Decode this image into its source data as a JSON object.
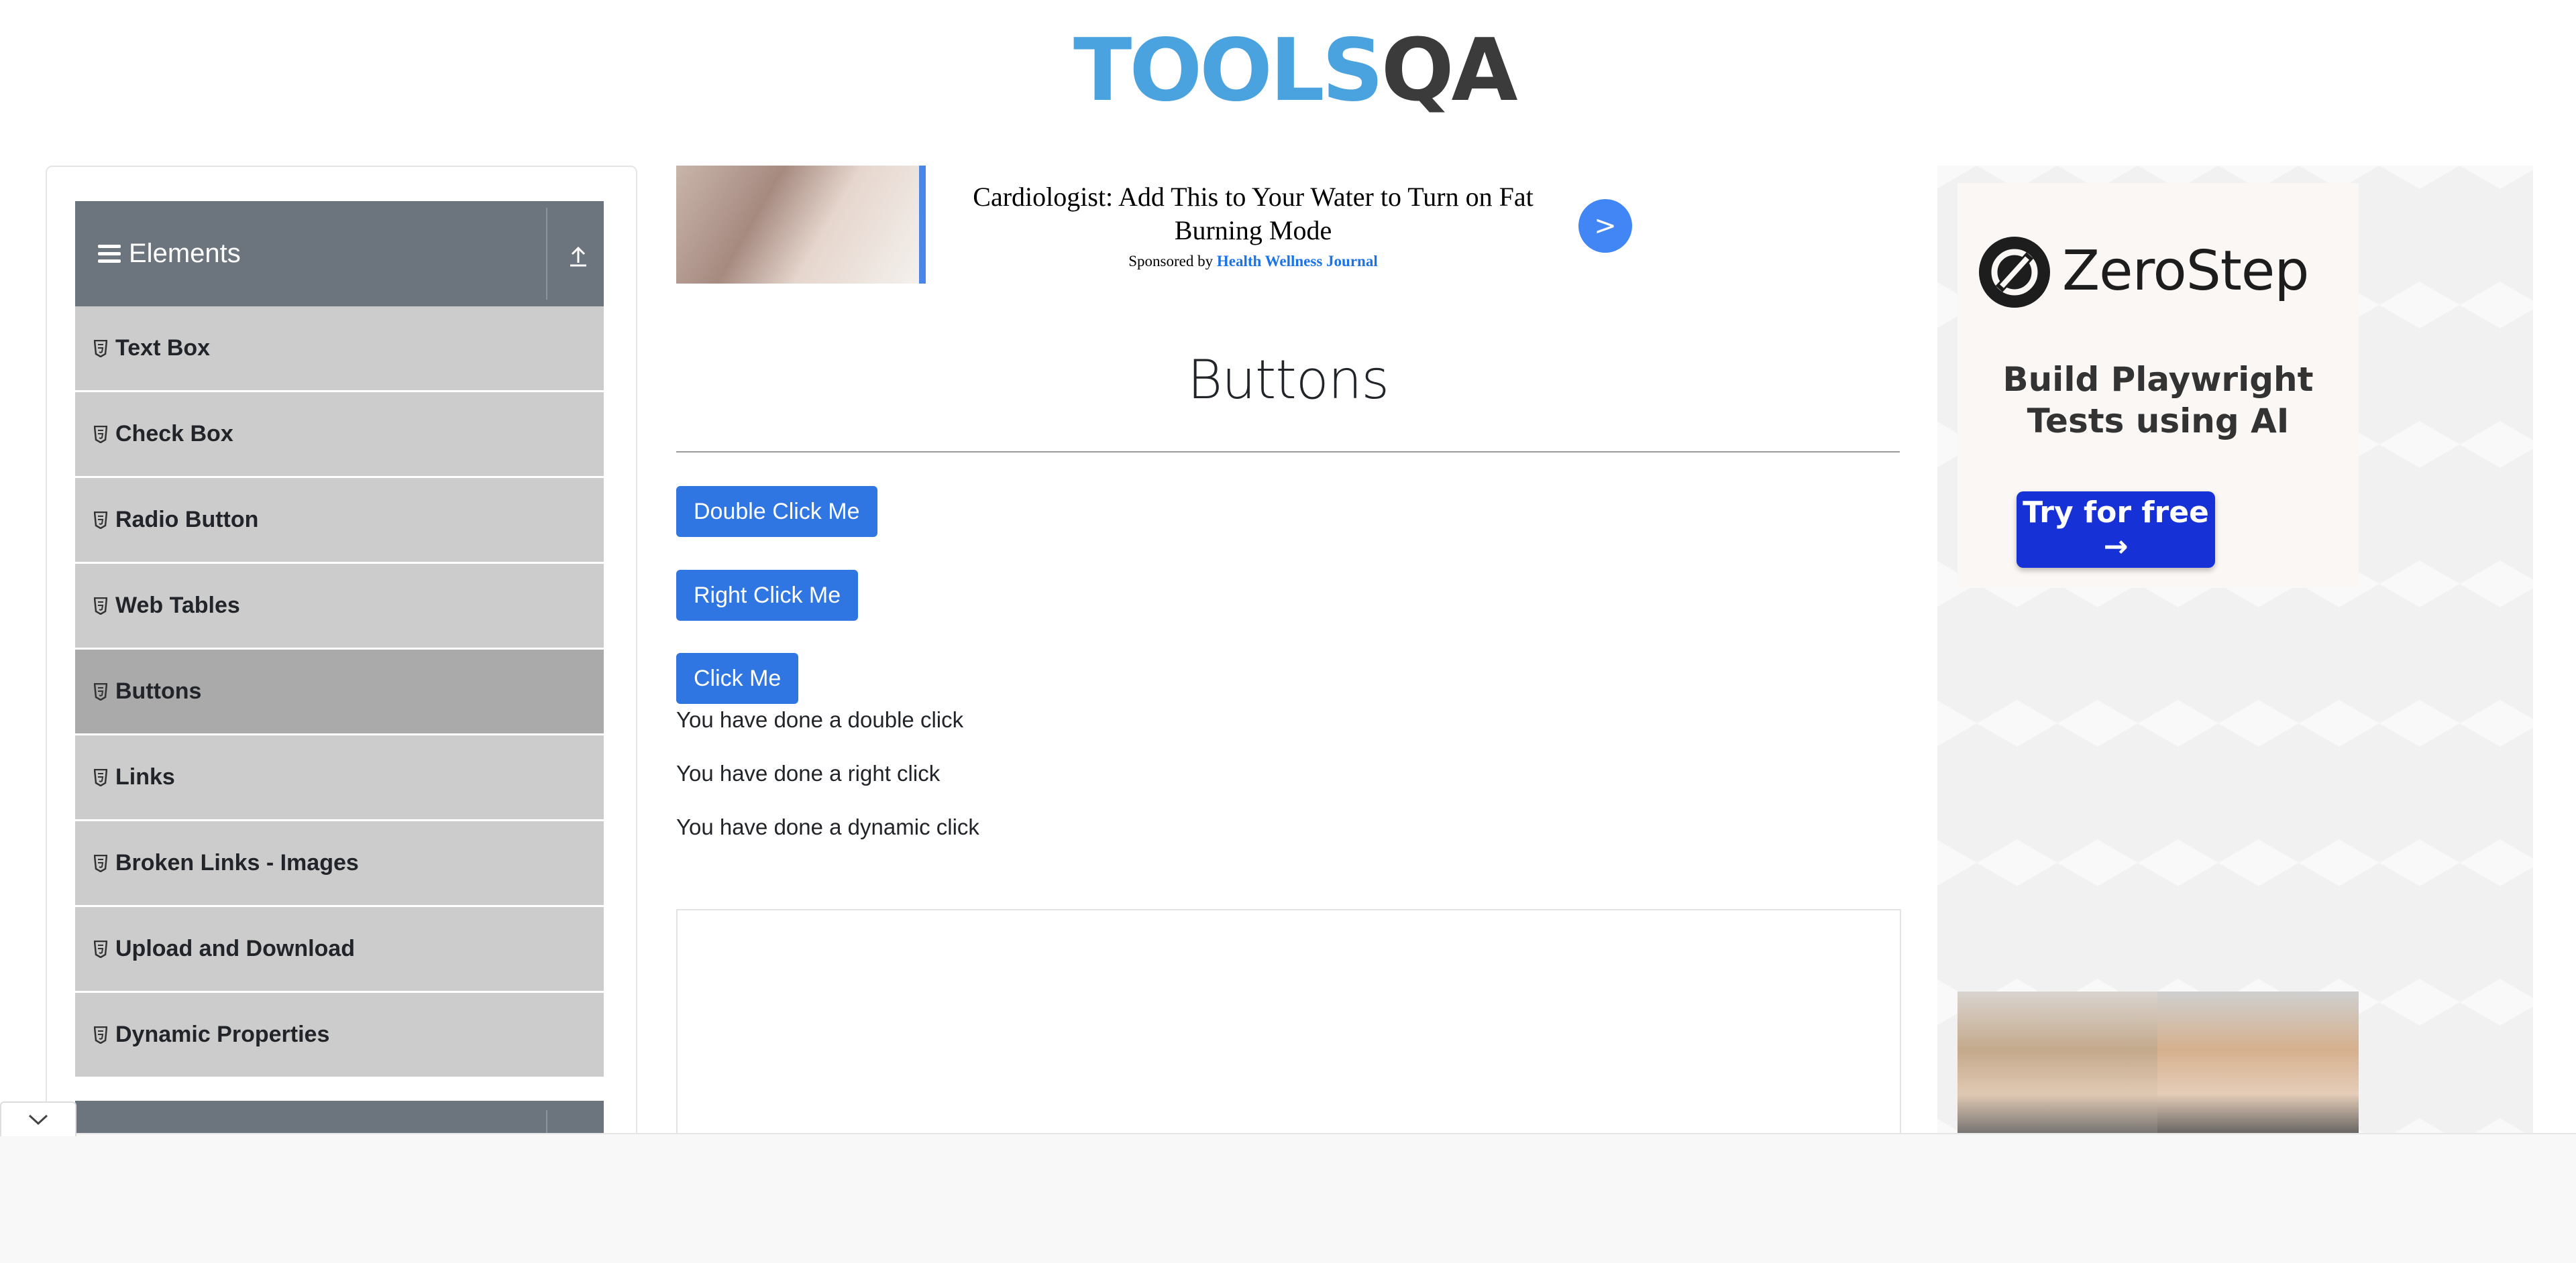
{
  "header": {
    "logo_text_light": "TOOLS",
    "logo_text_dark": "QA"
  },
  "sidebar": {
    "group_title": "Elements",
    "items": [
      {
        "label": "Text Box"
      },
      {
        "label": "Check Box"
      },
      {
        "label": "Radio Button"
      },
      {
        "label": "Web Tables"
      },
      {
        "label": "Buttons",
        "active": true
      },
      {
        "label": "Links"
      },
      {
        "label": "Broken Links - Images"
      },
      {
        "label": "Upload and Download"
      },
      {
        "label": "Dynamic Properties"
      }
    ]
  },
  "top_ad": {
    "headline": "Cardiologist: Add This to Your Water to Turn on Fat Burning Mode",
    "sponsor_prefix": "Sponsored by",
    "sponsor_name": "Health Wellness Journal",
    "arrow_label": ">"
  },
  "main": {
    "title": "Buttons",
    "buttons": {
      "double_click": "Double Click Me",
      "right_click": "Right Click Me",
      "click": "Click Me"
    },
    "messages": {
      "double": "You have done a double click",
      "right": "You have done a right click",
      "dynamic": "You have done a dynamic click"
    }
  },
  "right_ad": {
    "brand": "ZeroStep",
    "tagline": "Build Playwright Tests using AI",
    "cta": "Try for free →"
  },
  "colors": {
    "primary_button": "#2f76e3",
    "sidebar_header": "#6c757d",
    "menu_item": "#cccccc",
    "menu_item_active": "#aaaaaa",
    "cta": "#1631d6"
  },
  "icons": {
    "menu": "hamburger-icon",
    "collapse": "upload-icon",
    "item": "html5-shield-icon",
    "toggle": "chevron-down-icon"
  }
}
